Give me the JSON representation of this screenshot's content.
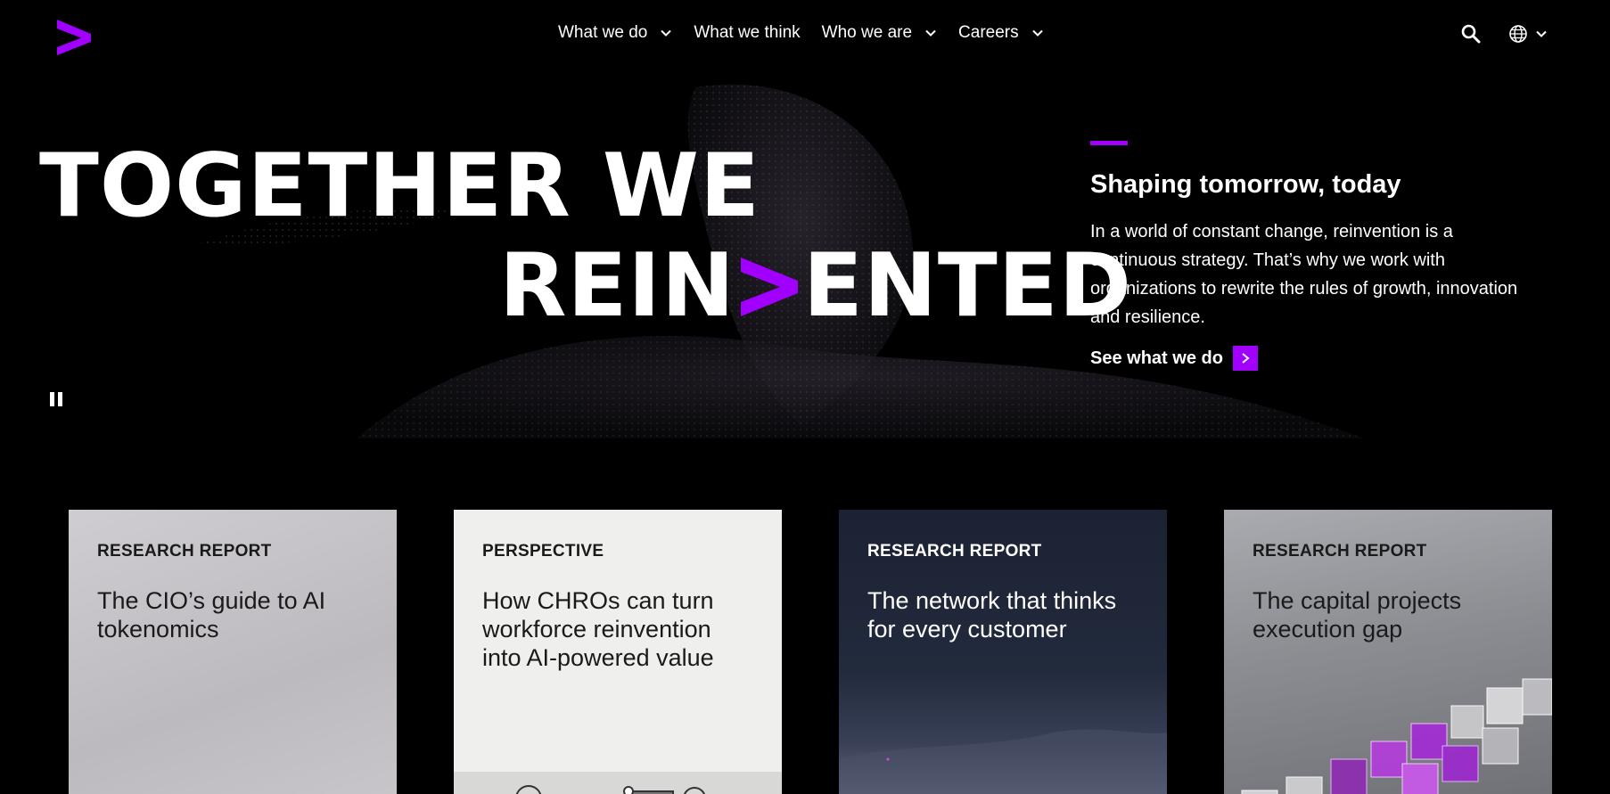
{
  "nav": {
    "items": [
      {
        "label": "What we do",
        "has_dropdown": true
      },
      {
        "label": "What we think",
        "has_dropdown": false
      },
      {
        "label": "Who we are",
        "has_dropdown": true
      },
      {
        "label": "Careers",
        "has_dropdown": true
      }
    ],
    "icons": [
      "accenture-logo-icon",
      "search-icon",
      "globe-icon",
      "chevron-down-icon"
    ]
  },
  "hero": {
    "headline_line1": "TOGETHER WE",
    "headline_line2_prefix": "REIN",
    "headline_line2_suffix": "ENTED",
    "side_title": "Shaping tomorrow, today",
    "side_body": "In a world of constant change, reinvention is a continuous strategy. That’s why we work with organizations to rewrite the rules of growth, innovation and resilience.",
    "cta_label": "See what we do"
  },
  "cards": [
    {
      "kicker": "RESEARCH REPORT",
      "title": "The CIO’s guide to AI tokenomics"
    },
    {
      "kicker": "PERSPECTIVE",
      "title": "How CHROs can turn workforce reinvention into AI-powered value"
    },
    {
      "kicker": "RESEARCH REPORT",
      "title": "The network that thinks for every customer"
    },
    {
      "kicker": "RESEARCH REPORT",
      "title": "The capital projects execution gap"
    }
  ],
  "colors": {
    "accent": "#a100ff",
    "background": "#000000",
    "text": "#ffffff"
  }
}
